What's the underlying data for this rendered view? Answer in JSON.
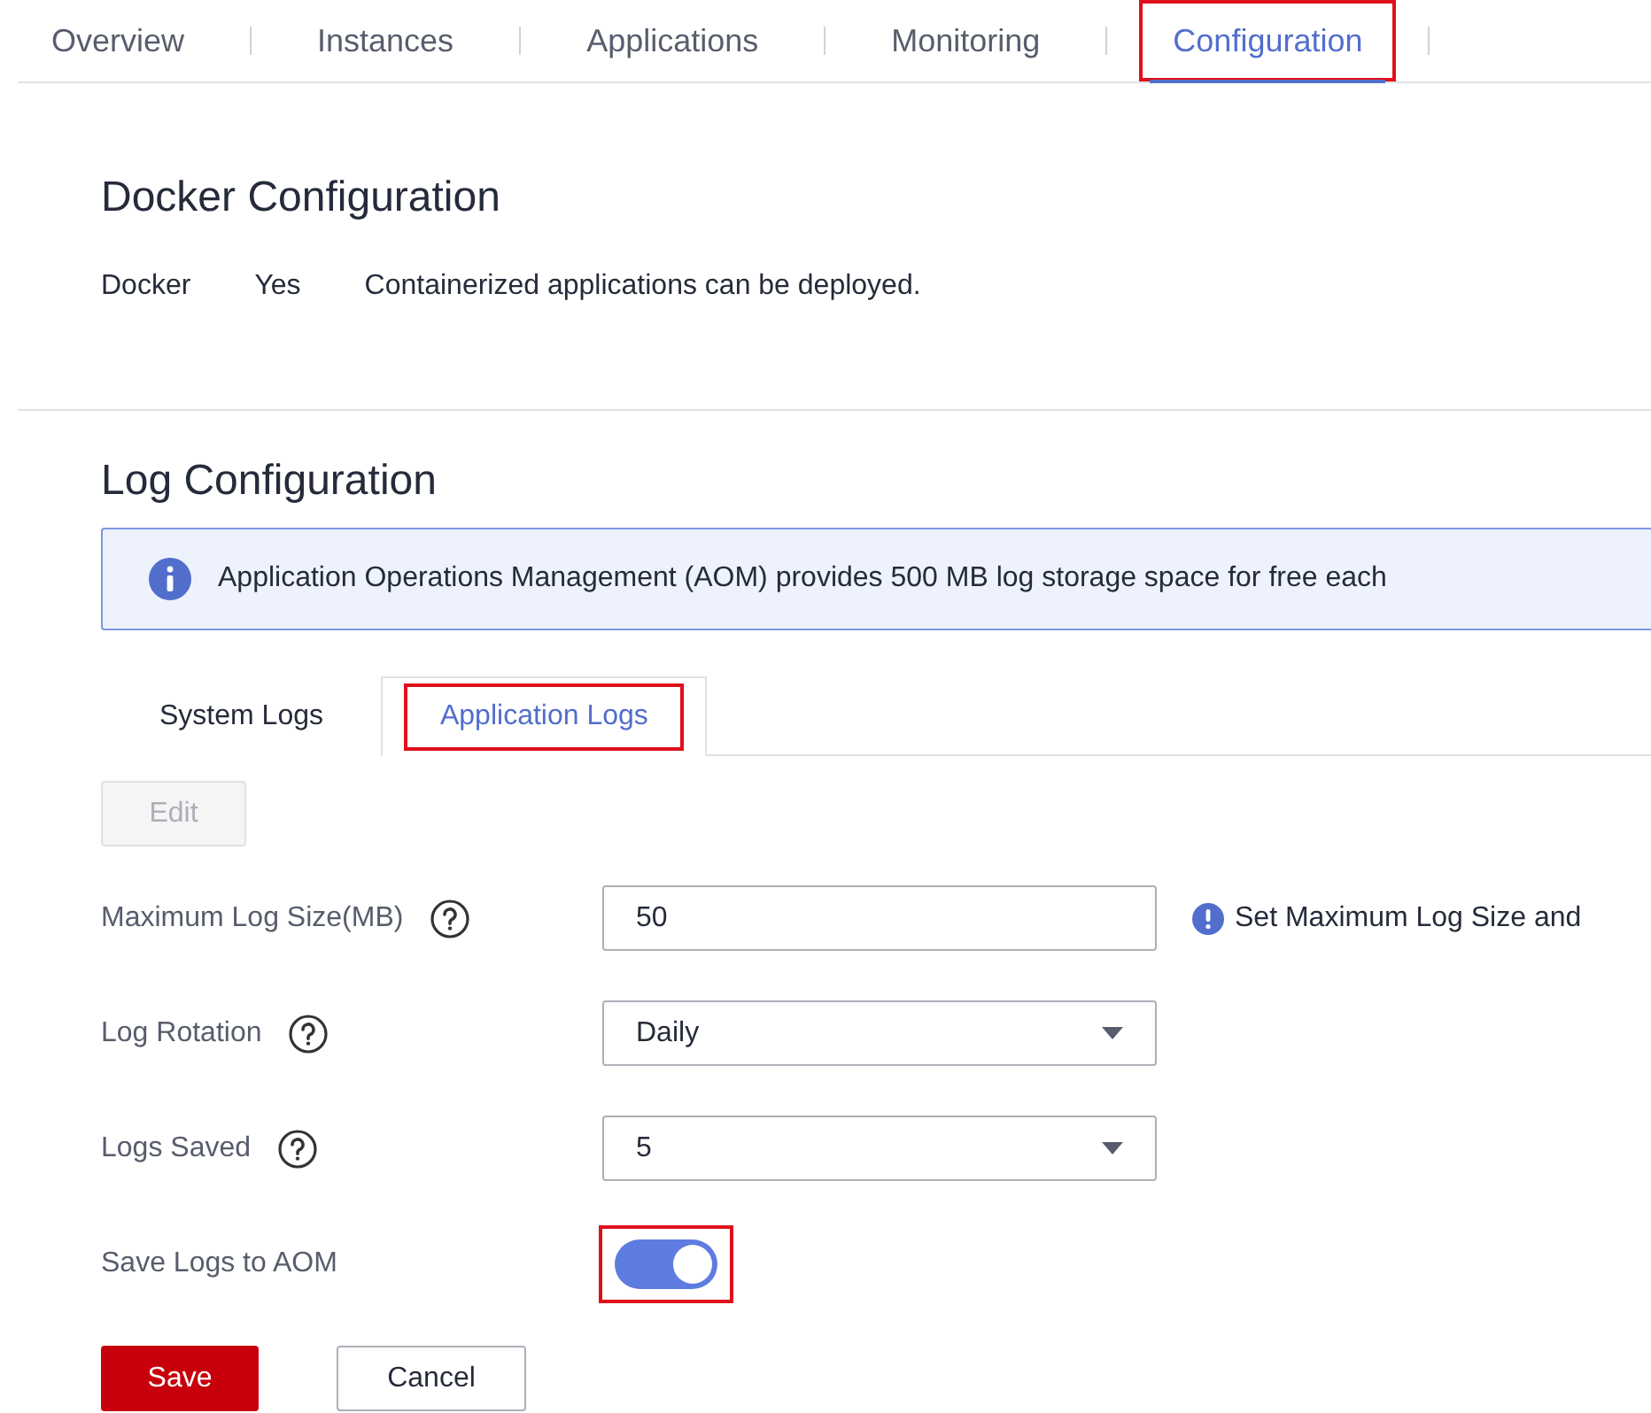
{
  "top_tabs": [
    {
      "label": "Overview",
      "selected": false,
      "highlighted": false
    },
    {
      "label": "Instances",
      "selected": false,
      "highlighted": false
    },
    {
      "label": "Applications",
      "selected": false,
      "highlighted": false
    },
    {
      "label": "Monitoring",
      "selected": false,
      "highlighted": false
    },
    {
      "label": "Configuration",
      "selected": true,
      "highlighted": true
    }
  ],
  "docker": {
    "title": "Docker Configuration",
    "label": "Docker",
    "value": "Yes",
    "description": "Containerized applications can be deployed."
  },
  "log": {
    "title": "Log Configuration",
    "notice": "Application Operations Management (AOM) provides 500 MB log storage space for free each",
    "tabs": [
      {
        "label": "System Logs",
        "selected": false,
        "highlighted": false
      },
      {
        "label": "Application Logs",
        "selected": true,
        "highlighted": true
      }
    ],
    "edit_button": {
      "label": "Edit",
      "disabled": true
    },
    "fields": [
      {
        "kind": "input",
        "label": "Maximum Log Size(MB)",
        "help": true,
        "value": "50",
        "hint": "Set Maximum Log Size and"
      },
      {
        "kind": "select",
        "label": "Log Rotation",
        "help": true,
        "value": "Daily"
      },
      {
        "kind": "select",
        "label": "Logs Saved",
        "help": true,
        "value": "5"
      },
      {
        "kind": "toggle",
        "label": "Save Logs to AOM",
        "help": false,
        "on": true,
        "highlighted": true
      }
    ],
    "buttons": [
      {
        "kind": "primary",
        "label": "Save"
      },
      {
        "kind": "secondary",
        "label": "Cancel"
      }
    ]
  }
}
